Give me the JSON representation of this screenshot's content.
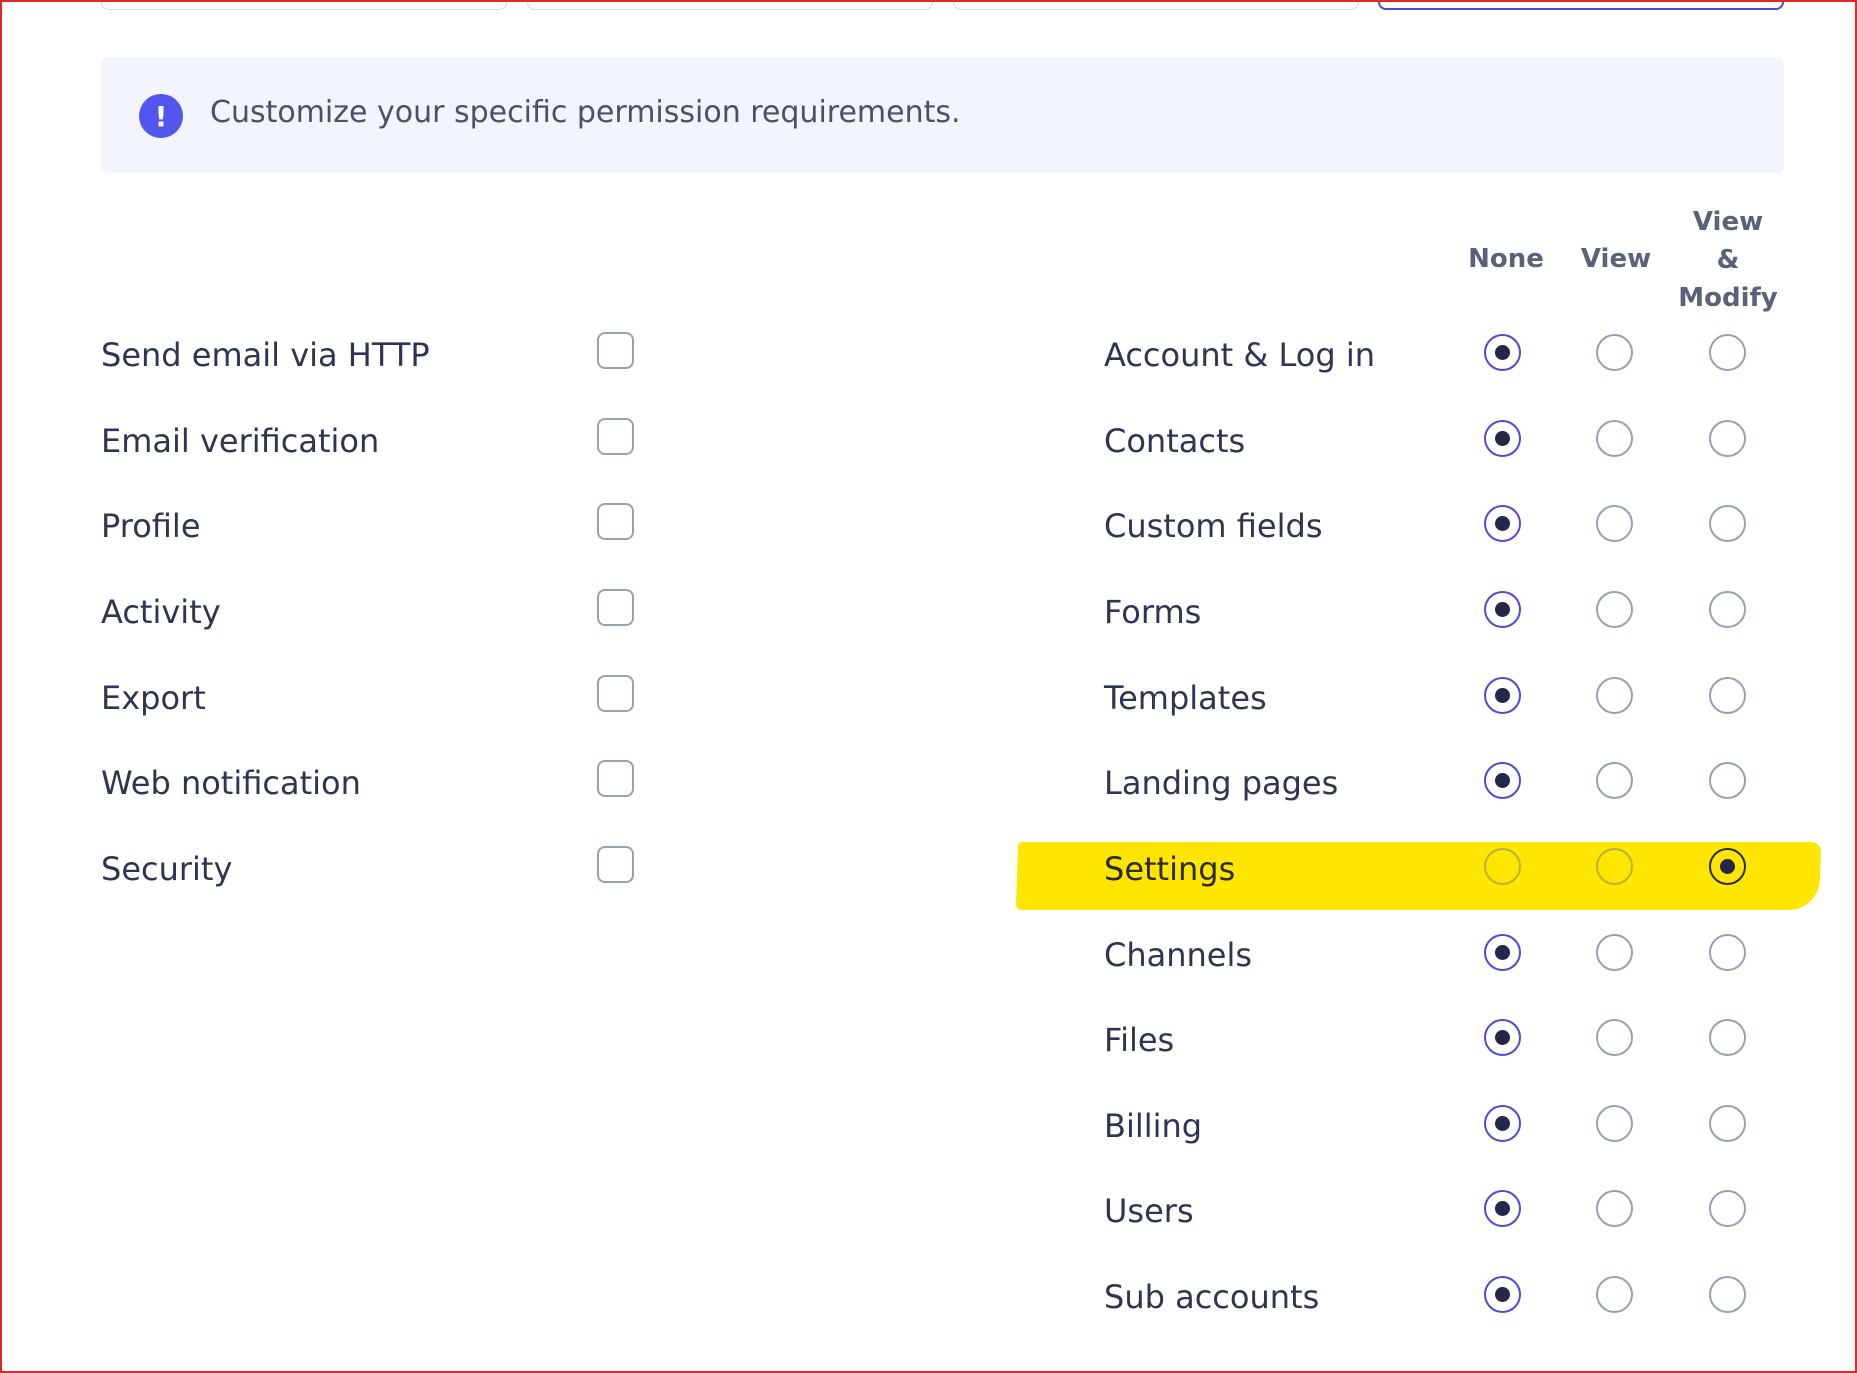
{
  "banner": {
    "icon": "exclamation-icon",
    "text": "Customize your specific permission requirements."
  },
  "columns": {
    "none": "None",
    "view": "View",
    "modify_line1": "View",
    "modify_line2": "&",
    "modify_line3": "Modify"
  },
  "features": [
    {
      "label": "Send email via HTTP",
      "checked": false
    },
    {
      "label": "Email verification",
      "checked": false
    },
    {
      "label": "Profile",
      "checked": false
    },
    {
      "label": "Activity",
      "checked": false
    },
    {
      "label": "Export",
      "checked": false
    },
    {
      "label": "Web notification",
      "checked": false
    },
    {
      "label": "Security",
      "checked": false
    }
  ],
  "access": [
    {
      "label": "Account & Log in",
      "value": "none"
    },
    {
      "label": "Contacts",
      "value": "none"
    },
    {
      "label": "Custom fields",
      "value": "none"
    },
    {
      "label": "Forms",
      "value": "none"
    },
    {
      "label": "Templates",
      "value": "none"
    },
    {
      "label": "Landing pages",
      "value": "none"
    },
    {
      "label": "Settings",
      "value": "modify",
      "highlighted": true
    },
    {
      "label": "Channels",
      "value": "none"
    },
    {
      "label": "Files",
      "value": "none"
    },
    {
      "label": "Billing",
      "value": "none"
    },
    {
      "label": "Users",
      "value": "none"
    },
    {
      "label": "Sub accounts",
      "value": "none"
    }
  ],
  "colors": {
    "accent": "#4b4bd6",
    "banner_bg": "#f2f4fe",
    "highlight": "#ffe600",
    "frame": "#e3262a"
  }
}
